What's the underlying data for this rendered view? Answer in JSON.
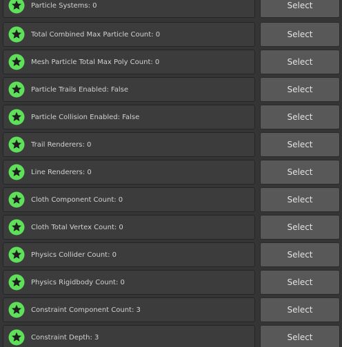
{
  "accent_color": "#5ee05a",
  "icon": "star-badge-icon",
  "select_label": "Select",
  "items": [
    {
      "label": "Particle Systems: 0"
    },
    {
      "label": "Total Combined Max Particle Count: 0"
    },
    {
      "label": "Mesh Particle Total Max Poly Count: 0"
    },
    {
      "label": "Particle Trails Enabled: False"
    },
    {
      "label": "Particle Collision Enabled: False"
    },
    {
      "label": "Trail Renderers: 0"
    },
    {
      "label": "Line Renderers: 0"
    },
    {
      "label": "Cloth Component Count: 0"
    },
    {
      "label": "Cloth Total Vertex Count: 0"
    },
    {
      "label": "Physics Collider Count: 0"
    },
    {
      "label": "Physics Rigidbody Count: 0"
    },
    {
      "label": "Constraint Component Count: 3"
    },
    {
      "label": "Constraint Depth: 3"
    }
  ]
}
